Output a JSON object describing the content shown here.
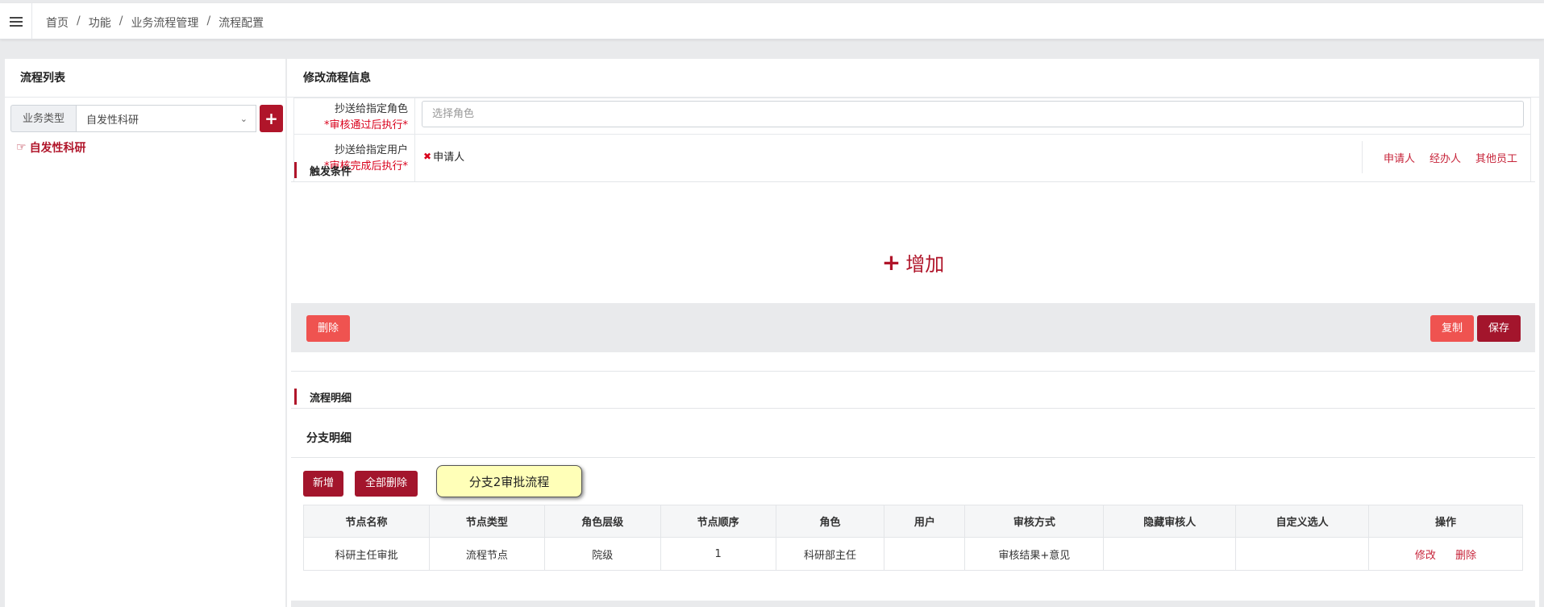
{
  "breadcrumb": [
    "首页",
    "功能",
    "业务流程管理",
    "流程配置"
  ],
  "left": {
    "title": "流程列表",
    "type_label": "业务类型",
    "type_value": "自发性科研",
    "tree_item": "自发性科研"
  },
  "right": {
    "title": "修改流程信息",
    "cc_role_label": "抄送给指定角色",
    "cc_role_note": "*审核通过后执行*",
    "cc_role_placeholder": "选择角色",
    "cc_user_label": "抄送给指定用户",
    "cc_user_note": "*审核完成后执行*",
    "cc_user_tag": "申请人",
    "cc_user_links": [
      "申请人",
      "经办人",
      "其他员工"
    ],
    "trigger_title": "触发条件",
    "add_label": "增加",
    "delete_label": "删除",
    "copy_label": "复制",
    "save_label": "保存",
    "detail_title": "流程明细",
    "branch_title": "分支明细",
    "new_label": "新增",
    "delete_all_label": "全部删除",
    "tooltip": "分支2审批流程"
  },
  "table": {
    "headers": [
      "节点名称",
      "节点类型",
      "角色层级",
      "节点顺序",
      "角色",
      "用户",
      "审核方式",
      "隐藏审核人",
      "自定义选人",
      "操作"
    ],
    "rows": [
      {
        "name": "科研主任审批",
        "type": "流程节点",
        "level": "院级",
        "order": "1",
        "role": "科研部主任",
        "user": "",
        "method": "审核结果+意见",
        "hidden": "",
        "custom": "",
        "edit": "修改",
        "del": "删除"
      }
    ]
  },
  "colors": {
    "primary": "#a3152c",
    "danger": "#ef5350",
    "link": "#c7243a"
  }
}
